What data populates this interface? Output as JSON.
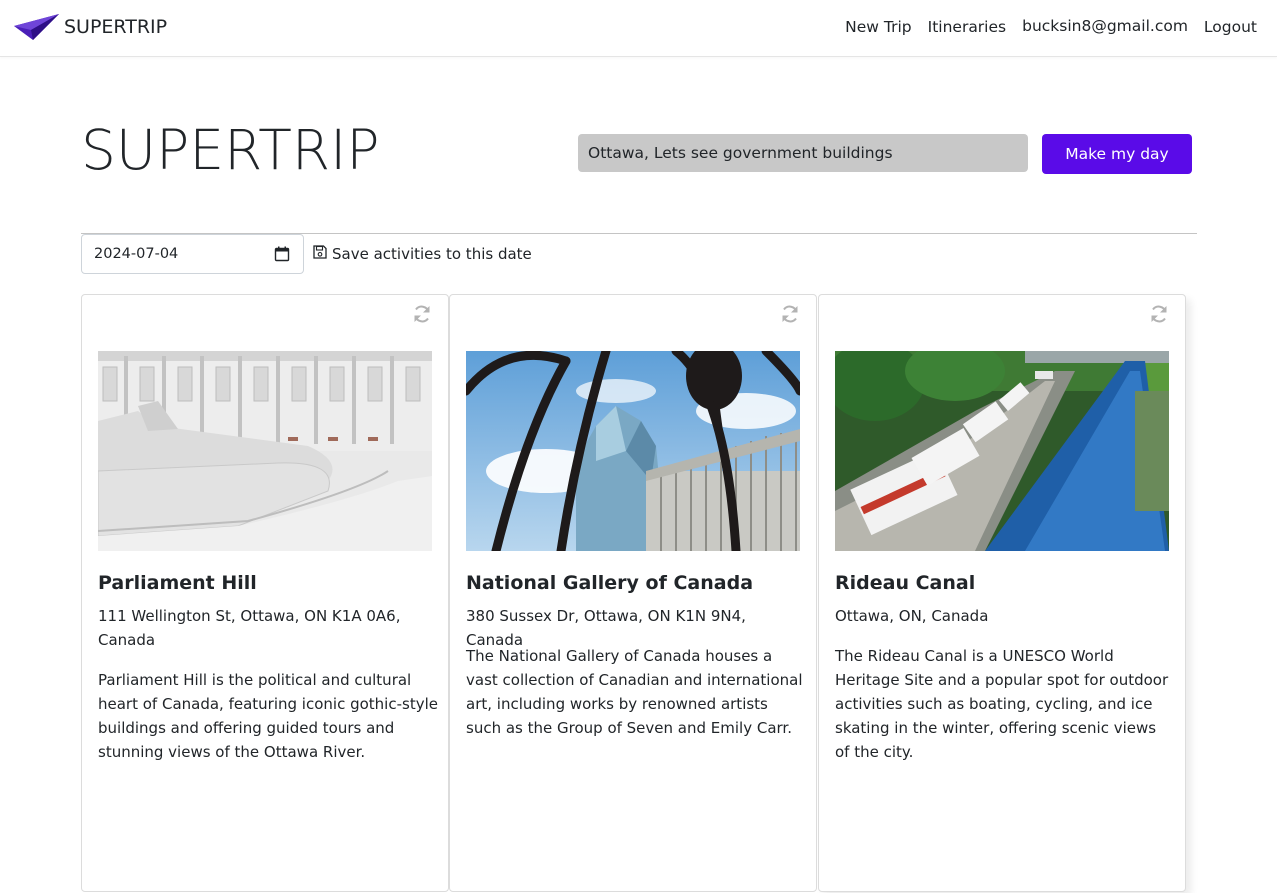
{
  "nav": {
    "brand": "SUPERTRIP",
    "links": [
      "New Trip",
      "Itineraries",
      "bucksin8@gmail.com",
      "Logout"
    ]
  },
  "hero": {
    "title": "SUPERTRIP",
    "query_value": "Ottawa, Lets see government buildings",
    "button_label": "Make my day"
  },
  "date_row": {
    "date_value": "2024-07-04",
    "save_label": "Save activities to this date"
  },
  "cards": [
    {
      "title": "Parliament Hill",
      "address": "111 Wellington St, Ottawa, ON K1A 0A6, Canada",
      "description": "Parliament Hill is the political and cultural heart of Canada, featuring iconic gothic-style buildings and offering guided tours and stunning views of the Ottawa River."
    },
    {
      "title": "National Gallery of Canada",
      "address": "380 Sussex Dr, Ottawa, ON K1N 9N4, Canada",
      "description": "The National Gallery of Canada houses a vast collection of Canadian and international art, including works by renowned artists such as the Group of Seven and Emily Carr."
    },
    {
      "title": "Rideau Canal",
      "address": "Ottawa, ON, Canada",
      "description": "The Rideau Canal is a UNESCO World Heritage Site and a popular spot for outdoor activities such as boating, cycling, and ice skating in the winter, offering scenic views of the city."
    }
  ],
  "colors": {
    "accent": "#5a0be8",
    "input_bg": "#c8c8c8",
    "logo": "#4a1fb8"
  },
  "icons": [
    "paper-plane-icon",
    "calendar-icon",
    "floppy-disk-icon",
    "refresh-icon"
  ]
}
